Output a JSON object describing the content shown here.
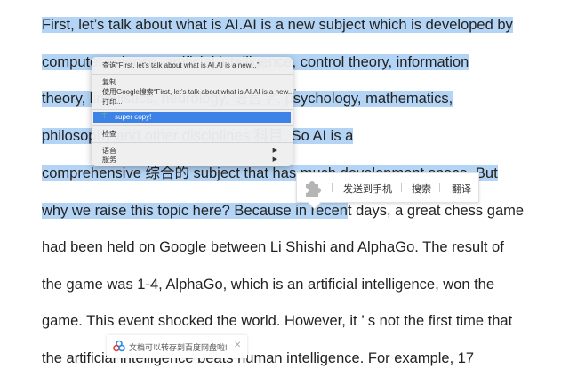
{
  "document": {
    "lines": [
      {
        "selected": "First, let’s talk about what is AI.AI is a new subject which is developed by",
        "rest": ""
      },
      {
        "selected": "computer science, artificial intelligence, control theory, information",
        "rest": ""
      },
      {
        "selected": "theory, linguistics, neurology, 语言学, psychology, mathematics,",
        "rest": ""
      },
      {
        "selected": "philosophy and other disciplines 科目. So AI is a",
        "rest": ""
      },
      {
        "selected": "comprehensive 综合的  subject that has much development space. But",
        "rest": ""
      },
      {
        "selected": "why we raise this topic here? Because in recen",
        "rest": "t days, a great chess game"
      },
      {
        "selected": "",
        "rest": "had been held on Google between Li Shishi and AlphaGo. The result of"
      },
      {
        "selected": "",
        "rest": "the game was 1-4, AlphaGo, which is an artificial intelligence, won the"
      },
      {
        "selected": "",
        "rest": "game. This event shocked the world. However, it ’ s not the first time that"
      },
      {
        "selected": "",
        "rest": "the artificial intelligence beats human intelligence. For example, 17"
      }
    ]
  },
  "context_menu": {
    "lookup": "查询“First, let’s talk about what is AI.AI is a new...”",
    "copy": "复制",
    "google_search": "使用Google搜索“First, let’s talk about what is AI.AI is a new...”",
    "print": "打印...",
    "super_copy": "super copy!",
    "inspect": "检查",
    "speech": "语音",
    "services": "服务"
  },
  "selection_bar": {
    "send_to_phone": "发送到手机",
    "search": "搜索",
    "translate": "翻译"
  },
  "toast": {
    "message": "文档可以转存到百度网盘啦!",
    "close": "✕"
  }
}
